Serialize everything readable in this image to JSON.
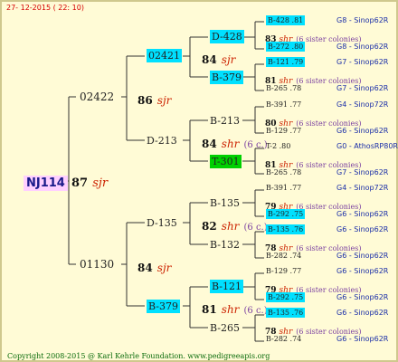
{
  "header": {
    "date": "27- 12-2015 ( 22: 10)"
  },
  "footer": {
    "copyright": "Copyright 2008-2015 @ Karl Kehrle Foundation.   www.pedigreeapis.org"
  },
  "root": {
    "id": "NJ114",
    "year": "87",
    "breeder": "sjr"
  },
  "gen1": [
    {
      "id": "02422",
      "year": "86",
      "breeder": "sjr"
    },
    {
      "id": "01130",
      "year": "84",
      "breeder": "sjr"
    }
  ],
  "gen2": [
    {
      "id": "02421",
      "year": "84",
      "breeder": "sjr",
      "highlight": "#00e0ff"
    },
    {
      "id": "D-213",
      "year": "84",
      "breeder": "shr",
      "note": "(6 c.)"
    },
    {
      "id": "D-135",
      "year": "82",
      "breeder": "shr",
      "note": "(6 c.)"
    },
    {
      "id": "B-379",
      "year": "81",
      "breeder": "shr",
      "note": "(6 c.)",
      "highlight": "#00e0ff"
    }
  ],
  "gen3": [
    {
      "id": "D-428",
      "highlight": "#00e0ff"
    },
    {
      "id": "B-379",
      "highlight": "#00e0ff"
    },
    {
      "id": "B-213"
    },
    {
      "id": "T-301",
      "highlight": "#00d000"
    },
    {
      "id": "B-135"
    },
    {
      "id": "B-132"
    },
    {
      "id": "B-121",
      "highlight": "#00e0ff"
    },
    {
      "id": "B-265"
    }
  ],
  "gen4": [
    {
      "id": "B-428 .81",
      "ref": "G8 - Sinop62R",
      "hl": true
    },
    {
      "year": "83",
      "breeder": "shr",
      "note": "(6 sister colonies)"
    },
    {
      "id": "B-272 .80",
      "ref": "G8 - Sinop62R",
      "hl": true
    },
    {
      "id": "B-121 .79",
      "ref": "G7 - Sinop62R",
      "hl": true
    },
    {
      "year": "81",
      "breeder": "shr",
      "note": "(6 sister colonies)"
    },
    {
      "id": "B-265 .78",
      "ref": "G7 - Sinop62R"
    },
    {
      "id": "B-391 .77",
      "ref": "G4 - Sinop72R"
    },
    {
      "year": "80",
      "breeder": "shr",
      "note": "(6 sister colonies)"
    },
    {
      "id": "B-129 .77",
      "ref": "G6 - Sinop62R"
    },
    {
      "id": "T-2 .80",
      "ref": "G0 - AthosRP80R"
    },
    {
      "year": "81",
      "breeder": "shr",
      "note": "(6 sister colonies)"
    },
    {
      "id": "B-265 .78",
      "ref": "G7 - Sinop62R"
    },
    {
      "id": "B-391 .77",
      "ref": "G4 - Sinop72R"
    },
    {
      "year": "79",
      "breeder": "shr",
      "note": "(6 sister colonies)"
    },
    {
      "id": "B-292 .75",
      "ref": "G6 - Sinop62R",
      "hl": true
    },
    {
      "id": "B-135 .76",
      "ref": "G6 - Sinop62R",
      "hl": true
    },
    {
      "year": "78",
      "breeder": "shr",
      "note": "(6 sister colonies)"
    },
    {
      "id": "B-282 .74",
      "ref": "G6 - Sinop62R"
    },
    {
      "id": "B-129 .77",
      "ref": "G6 - Sinop62R"
    },
    {
      "year": "79",
      "breeder": "shr",
      "note": "(6 sister colonies)"
    },
    {
      "id": "B-292 .75",
      "ref": "G6 - Sinop62R",
      "hl": true
    },
    {
      "id": "B-135 .76",
      "ref": "G6 - Sinop62R",
      "hl": true
    },
    {
      "year": "78",
      "breeder": "shr",
      "note": "(6 sister colonies)"
    },
    {
      "id": "B-282 .74",
      "ref": "G6 - Sinop62R"
    }
  ]
}
